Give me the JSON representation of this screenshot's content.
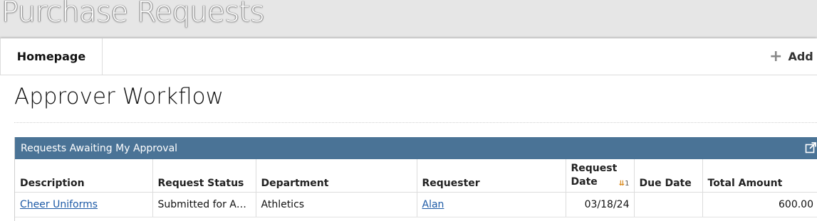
{
  "app": {
    "title": "Purchase Requests"
  },
  "nav": {
    "home_tab": "Homepage",
    "add_label": "Add"
  },
  "section": {
    "title": "Approver Workflow"
  },
  "widget": {
    "title": "Requests Awaiting My Approval",
    "columns": [
      "Description",
      "Request Status",
      "Department",
      "Requester",
      "Request Date",
      "Due Date",
      "Total Amount"
    ],
    "sort": {
      "column": "Request Date",
      "order": "1",
      "direction": "descending"
    },
    "rows": [
      {
        "description": "Cheer Uniforms",
        "status": "Submitted for Ap…",
        "department": "Athletics",
        "requester": "Alan",
        "request_date": "03/18/24",
        "due_date": "",
        "total_amount": "600.00"
      }
    ]
  },
  "colors": {
    "header_bar": "#4a7396",
    "link": "#1d5aa6",
    "sort_indicator": "#d98a1e"
  }
}
